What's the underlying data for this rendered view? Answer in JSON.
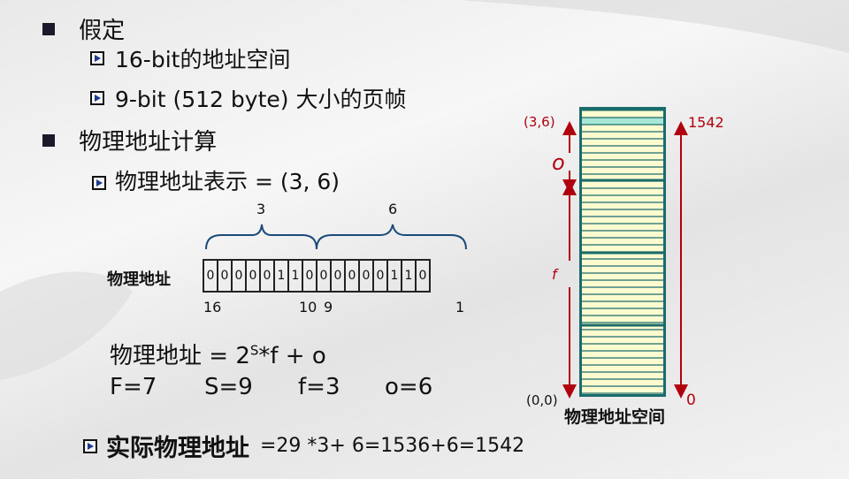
{
  "bullets": {
    "assume": "假定",
    "addr_space": "16-bit的地址空间",
    "frame_size": "9-bit (512 byte) 大小的页帧",
    "calc": "物理地址计算",
    "repr": "物理地址表示 =  (3, 6)"
  },
  "bit_diagram": {
    "label": "物理地址",
    "group_labels": [
      "3",
      "6"
    ],
    "bits_high": [
      "0",
      "0",
      "0",
      "0",
      "0",
      "1",
      "1"
    ],
    "bits_low": [
      "0",
      "0",
      "0",
      "0",
      "0",
      "0",
      "1",
      "1",
      "0"
    ],
    "index_labels": {
      "left": "16",
      "mid_left": "10",
      "mid_right": "9",
      "right": "1"
    }
  },
  "formula": {
    "prefix": "物理地址 = 2",
    "sup": "S",
    "suffix": "*f + o",
    "params": [
      "F=7",
      "S=9",
      "f=3",
      "o=6"
    ]
  },
  "result": {
    "label": "实际物理地址",
    "expr": "=29 *3+ 6=1536+6=1542"
  },
  "memory": {
    "top_left": "(3,6)",
    "top_right": "1542",
    "offset_label": "o",
    "frame_label": "f",
    "bottom_left": "(0,0)",
    "bottom_right": "0",
    "caption": "物理地址空间"
  },
  "colors": {
    "accent_red": "#b00010",
    "frame_border": "#1a6b6b",
    "frame_fill": "#fffbd0"
  }
}
